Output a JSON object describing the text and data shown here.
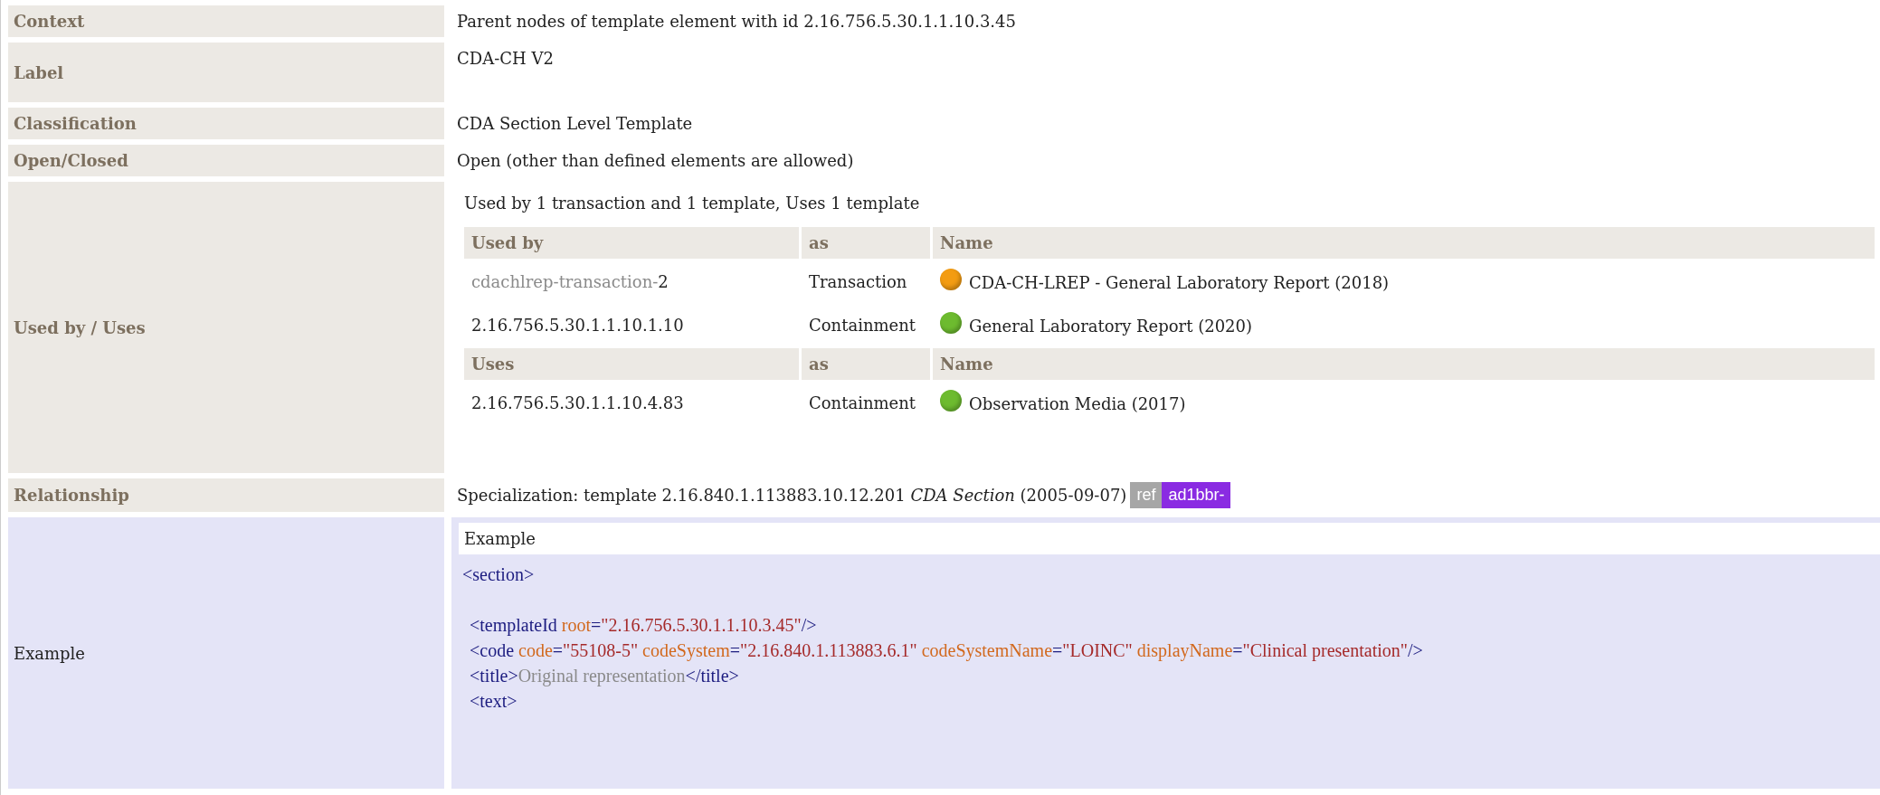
{
  "rows": [
    {
      "kind": "text",
      "label": "Context",
      "value": "Parent nodes of template element with id 2.16.756.5.30.1.1.10.3.45"
    },
    {
      "kind": "tall",
      "label": "Label",
      "value": "CDA-CH V2"
    },
    {
      "kind": "text",
      "label": "Classification",
      "value": "CDA Section Level Template"
    },
    {
      "kind": "text",
      "label": "Open/Closed",
      "value": "Open (other than defined elements are allowed)"
    },
    {
      "kind": "usage",
      "label": "Used by / Uses",
      "summary": "Used by 1 transaction and 1 template, Uses 1 template",
      "groups": [
        {
          "headers": [
            "Used by",
            "as",
            "Name"
          ],
          "items": [
            {
              "prefix": "cdachlrep-transaction-",
              "id": "2",
              "as": "Transaction",
              "color": "#f39c12",
              "name": "CDA-CH-LREP - General Laboratory Report (2018)"
            },
            {
              "id": "2.16.756.5.30.1.1.10.1.10",
              "as": "Containment",
              "color": "#6dbb2f",
              "name": "General Laboratory Report (2020)"
            }
          ]
        },
        {
          "headers": [
            "Uses",
            "as",
            "Name"
          ],
          "items": [
            {
              "id": "2.16.756.5.30.1.1.10.4.83",
              "as": "Containment",
              "color": "#6dbb2f",
              "name": "Observation Media (2017)"
            }
          ]
        }
      ]
    },
    {
      "kind": "relationship",
      "label": "Relationship",
      "value": "Specialization: template 2.16.840.1.113883.10.12.201 *CDA Section* (2005-09-07)",
      "badges": [
        {
          "text": "ref",
          "color": "#a6a6a6"
        },
        {
          "text": "ad1bbr-",
          "color": "#8a2be2"
        }
      ]
    },
    {
      "kind": "example",
      "label": "Example",
      "title": "Example",
      "lines": [
        {
          "blank_after": true,
          "tokens": [
            {
              "kind": "tag",
              "s": "<section>"
            }
          ]
        },
        {
          "tokens": [
            {
              "kind": "tag",
              "s": "<templateId"
            },
            {
              "kind": "attr",
              "s": " root"
            },
            {
              "kind": "tag",
              "s": "="
            },
            {
              "kind": "val",
              "s": "\"2.16.756.5.30.1.1.10.3.45\""
            },
            {
              "kind": "tag",
              "s": "/>"
            }
          ]
        },
        {
          "tokens": [
            {
              "kind": "tag",
              "s": "<code"
            },
            {
              "kind": "attr",
              "s": " code"
            },
            {
              "kind": "tag",
              "s": "="
            },
            {
              "kind": "val",
              "s": "\"55108-5\""
            },
            {
              "kind": "attr",
              "s": " codeSystem"
            },
            {
              "kind": "tag",
              "s": "="
            },
            {
              "kind": "val",
              "s": "\"2.16.840.1.113883.6.1\""
            },
            {
              "kind": "attr",
              "s": " codeSystemName"
            },
            {
              "kind": "tag",
              "s": "="
            },
            {
              "kind": "val",
              "s": "\"LOINC\""
            },
            {
              "kind": "attr",
              "s": " displayName"
            },
            {
              "kind": "tag",
              "s": "="
            },
            {
              "kind": "val",
              "s": "\"Clinical presentation\""
            },
            {
              "kind": "tag",
              "s": "/>"
            }
          ]
        },
        {
          "tokens": [
            {
              "kind": "tag",
              "s": "<title>"
            },
            {
              "kind": "text",
              "s": "Original representation"
            },
            {
              "kind": "tag",
              "s": "</title>"
            }
          ]
        },
        {
          "tokens": [
            {
              "kind": "tag",
              "s": "<text>"
            }
          ]
        }
      ]
    }
  ]
}
